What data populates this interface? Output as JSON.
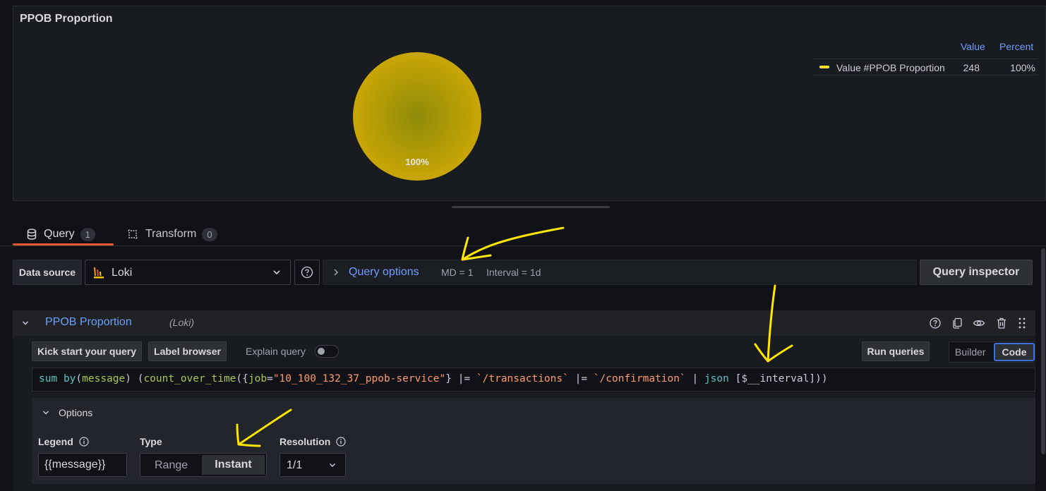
{
  "panel": {
    "title": "PPOB Proportion",
    "pie_label": "100%",
    "legend": {
      "col_value": "Value",
      "col_percent": "Percent",
      "row_name": "Value #PPOB Proportion",
      "row_value": "248",
      "row_percent": "100%"
    }
  },
  "chart_data": {
    "type": "pie",
    "title": "PPOB Proportion",
    "slices": [
      {
        "name": "Value #PPOB Proportion",
        "value": 248,
        "percent": 100,
        "color": "#c9a606"
      }
    ]
  },
  "tabs": [
    {
      "label": "Query",
      "count": "1"
    },
    {
      "label": "Transform",
      "count": "0"
    }
  ],
  "datasource": {
    "label": "Data source",
    "selected": "Loki"
  },
  "query_options": {
    "label": "Query options",
    "md": "MD = 1",
    "interval": "Interval = 1d"
  },
  "query_inspector_label": "Query inspector",
  "query_row": {
    "name": "PPOB Proportion",
    "datasource": "(Loki)"
  },
  "toolbar": {
    "kick_start": "Kick start your query",
    "label_browser": "Label browser",
    "explain": "Explain query",
    "run": "Run queries",
    "builder": "Builder",
    "code": "Code"
  },
  "code": {
    "sum": "sum",
    "by": "by",
    "message": "message",
    "count": "count_over_time",
    "job_key": "job",
    "job_val": "\"10_100_132_37_ppob-service\"",
    "filter1": "`/transactions`",
    "filter2": "`/confirmation`",
    "json": "json",
    "interval": "[$__interval]"
  },
  "options": {
    "title": "Options",
    "legend_label": "Legend",
    "legend_value": "{{message}}",
    "type_label": "Type",
    "type_range": "Range",
    "type_instant": "Instant",
    "resolution_label": "Resolution",
    "resolution_value": "1/1"
  },
  "colors": {
    "accent_blue": "#6e9fff",
    "tab_underline": "#f05a28",
    "pie_fill": "#c9a606",
    "annotation": "#ffe500"
  }
}
